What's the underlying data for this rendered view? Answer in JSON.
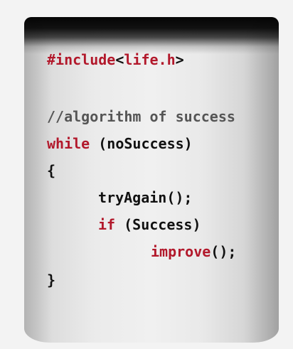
{
  "code": {
    "include_directive": "#include",
    "include_open": "<",
    "include_file": "life.h",
    "include_close": ">",
    "comment": "//algorithm of success",
    "while_keyword": "while",
    "while_condition": " (noSuccess)",
    "open_brace": "{",
    "try_again_call": "tryAgain();",
    "if_keyword": "if",
    "if_condition": " (Success)",
    "improve_name": "improve",
    "improve_call_suffix": "();",
    "close_brace": "}"
  },
  "colors": {
    "keyword": "#b2182b",
    "text": "#111111",
    "comment": "#555555",
    "mug_rim": "#050505",
    "mug_body": "#f0f0f0"
  }
}
